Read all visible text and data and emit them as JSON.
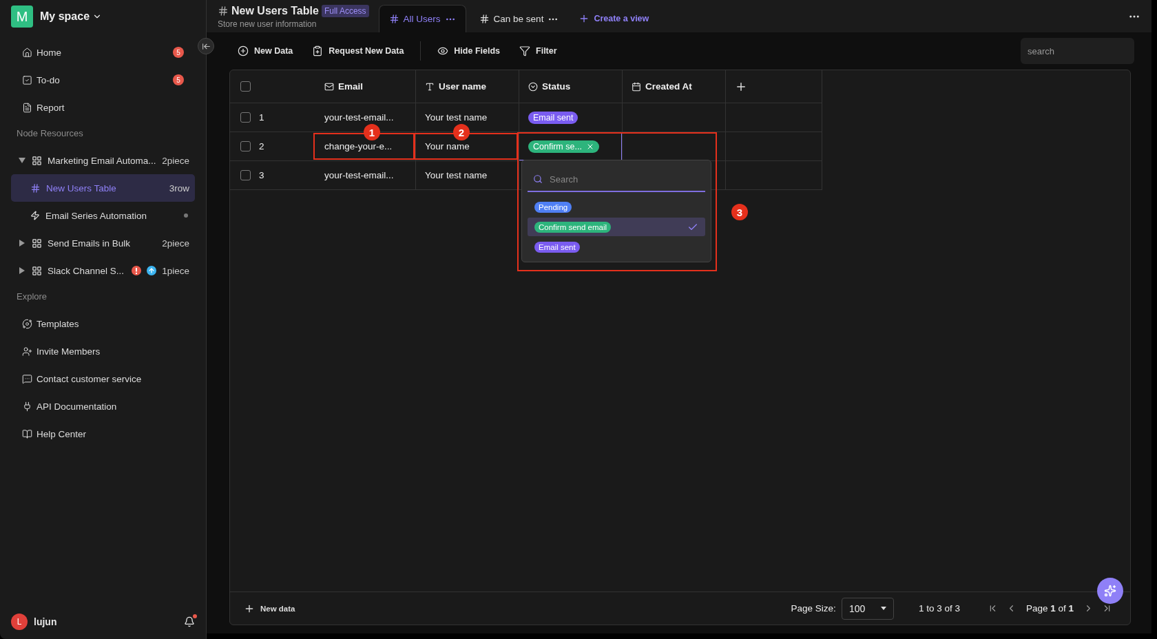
{
  "workspace": {
    "initial": "M",
    "name": "My space"
  },
  "nav": [
    {
      "label": "Home",
      "badge": "5"
    },
    {
      "label": "To-do",
      "badge": "5"
    },
    {
      "label": "Report"
    }
  ],
  "node_resources": {
    "title": "Node Resources",
    "items": [
      {
        "label": "Marketing Email Automa...",
        "count": "2piece",
        "kind": "folder",
        "expanded": true,
        "selected": false,
        "children": [
          {
            "label": "New Users Table",
            "count": "3row",
            "kind": "table",
            "selected": true
          },
          {
            "label": "Email Series Automation",
            "kind": "automation",
            "selected": false,
            "dot": true
          }
        ]
      },
      {
        "label": "Send Emails in Bulk",
        "count": "2piece",
        "kind": "folder",
        "expanded": false,
        "selected": false
      },
      {
        "label": "Slack Channel S...",
        "count": "1piece",
        "kind": "folder",
        "expanded": false,
        "selected": false,
        "indicators": [
          {
            "kind": "error"
          },
          {
            "kind": "update"
          }
        ]
      }
    ]
  },
  "explore": {
    "title": "Explore",
    "items": [
      {
        "label": "Templates"
      },
      {
        "label": "Invite Members"
      },
      {
        "label": "Contact customer service"
      },
      {
        "label": "API Documentation"
      },
      {
        "label": "Help Center"
      }
    ]
  },
  "user": {
    "initial": "L",
    "name": "lujun",
    "notification": true
  },
  "header": {
    "title": "New Users Table",
    "access": "Full Access",
    "subtitle": "Store new user information"
  },
  "views": [
    {
      "label": "All Users",
      "selected": true
    },
    {
      "label": "Can be sent",
      "selected": false
    }
  ],
  "create_view": "Create a view",
  "toolbar": [
    {
      "label": "New Data"
    },
    {
      "label": "Request New Data"
    },
    {
      "label": "Hide Fields"
    },
    {
      "label": "Filter"
    }
  ],
  "search": {
    "placeholder": "search"
  },
  "table": {
    "all_checked": false,
    "columns": [
      {
        "label": "Email"
      },
      {
        "label": "User name"
      },
      {
        "label": "Status"
      },
      {
        "label": "Created At"
      }
    ],
    "rows": [
      {
        "number": "1",
        "checked": false,
        "email": "your-test-email...",
        "user_name": "Your test name",
        "status": {
          "label": "Email sent",
          "color": "#7a5cf0"
        },
        "editing": false
      },
      {
        "number": "2",
        "checked": false,
        "email": "change-your-e...",
        "user_name": "Your name",
        "status": {
          "label": "Confirm se...",
          "color": "#2db47c"
        },
        "editing": true,
        "markers": [
          {
            "label": "1"
          },
          {
            "label": "2"
          },
          {
            "label": "3"
          }
        ]
      },
      {
        "number": "3",
        "checked": false,
        "email": "your-test-email...",
        "user_name": "Your test name",
        "editing": false
      }
    ]
  },
  "status_dropdown": {
    "search_placeholder": "Search",
    "options": [
      {
        "label": "Pending",
        "color": "#4f7ff5",
        "selected": false
      },
      {
        "label": "Confirm send email",
        "color": "#2db47c",
        "selected": true
      },
      {
        "label": "Email sent",
        "color": "#7a5cf0",
        "selected": false
      }
    ]
  },
  "footer": {
    "new_data": "New data",
    "page_size_label": "Page Size:",
    "page_size": "100",
    "range": "1 to 3 of 3",
    "page": "Page **1** of **1**"
  }
}
